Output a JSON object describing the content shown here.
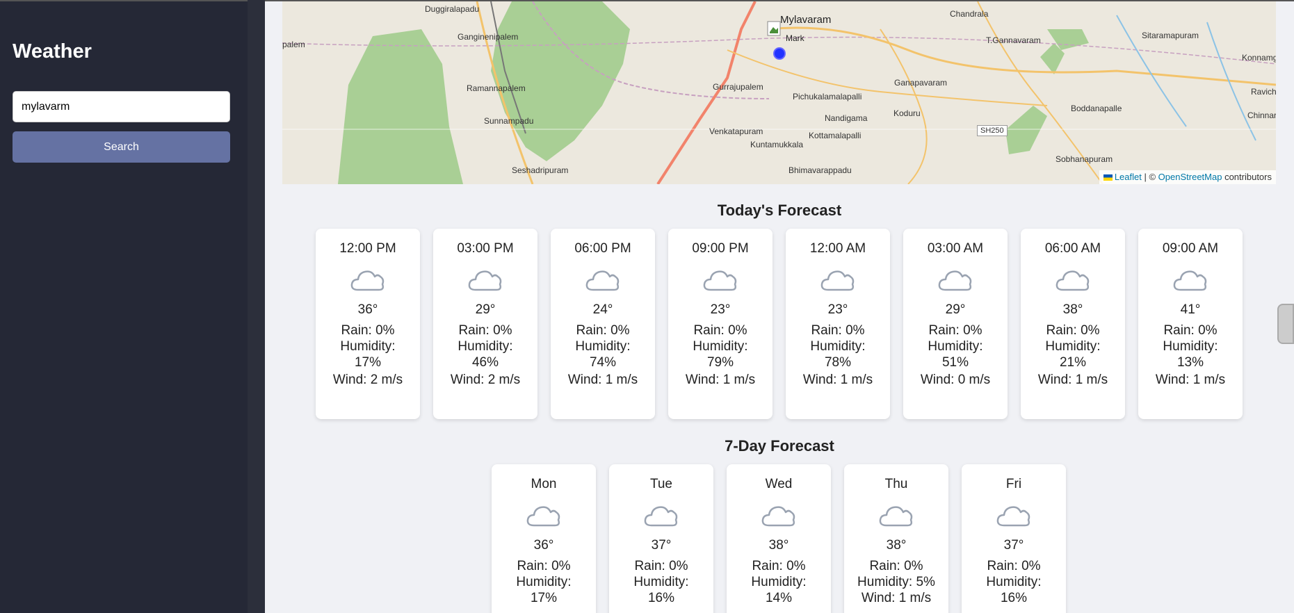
{
  "sidebar": {
    "title": "Weather",
    "search_value": "mylavarm",
    "search_button": "Search"
  },
  "map": {
    "labels": [
      "Duggiralapadu",
      "Ganginenipalem",
      "Ramannapalem",
      "Sunnampadu",
      "Seshadripuram",
      "palem",
      "Mylavaram",
      "Gurrajupalem",
      "Pichukalamalapalli",
      "Venkatapuram",
      "Kuntamukkala",
      "Kottamalapalli",
      "Nandigama",
      "Koduru",
      "Ganapavaram",
      "Chandrala",
      "T.Gannavaram",
      "Sitaramapuram",
      "Konnamgu",
      "Boddanapalle",
      "Ravich",
      "Chinnaravi",
      "Sobhanapuram",
      "Bhimavarappadu"
    ],
    "road_shield": "SH250",
    "marker_label": "Mark",
    "attribution": {
      "leaflet": "Leaflet",
      "separator": " | © ",
      "osm": "OpenStreetMap",
      "suffix": " contributors"
    }
  },
  "today": {
    "title": "Today's Forecast",
    "items": [
      {
        "time": "12:00 PM",
        "temp": "36°",
        "rain": "Rain: 0%",
        "humidity_label": "Humidity:",
        "humidity": "17%",
        "wind": "Wind: 2 m/s",
        "icon": "cloud-icon"
      },
      {
        "time": "03:00 PM",
        "temp": "29°",
        "rain": "Rain: 0%",
        "humidity_label": "Humidity:",
        "humidity": "46%",
        "wind": "Wind: 2 m/s",
        "icon": "cloud-icon"
      },
      {
        "time": "06:00 PM",
        "temp": "24°",
        "rain": "Rain: 0%",
        "humidity_label": "Humidity:",
        "humidity": "74%",
        "wind": "Wind: 1 m/s",
        "icon": "cloud-icon"
      },
      {
        "time": "09:00 PM",
        "temp": "23°",
        "rain": "Rain: 0%",
        "humidity_label": "Humidity:",
        "humidity": "79%",
        "wind": "Wind: 1 m/s",
        "icon": "cloud-icon"
      },
      {
        "time": "12:00 AM",
        "temp": "23°",
        "rain": "Rain: 0%",
        "humidity_label": "Humidity:",
        "humidity": "78%",
        "wind": "Wind: 1 m/s",
        "icon": "cloud-icon"
      },
      {
        "time": "03:00 AM",
        "temp": "29°",
        "rain": "Rain: 0%",
        "humidity_label": "Humidity:",
        "humidity": "51%",
        "wind": "Wind: 0 m/s",
        "icon": "cloud-icon"
      },
      {
        "time": "06:00 AM",
        "temp": "38°",
        "rain": "Rain: 0%",
        "humidity_label": "Humidity:",
        "humidity": "21%",
        "wind": "Wind: 1 m/s",
        "icon": "cloud-icon"
      },
      {
        "time": "09:00 AM",
        "temp": "41°",
        "rain": "Rain: 0%",
        "humidity_label": "Humidity:",
        "humidity": "13%",
        "wind": "Wind: 1 m/s",
        "icon": "cloud-icon"
      }
    ]
  },
  "week": {
    "title": "7-Day Forecast",
    "items": [
      {
        "day": "Mon",
        "temp": "36°",
        "rain": "Rain: 0%",
        "humidity_label": "Humidity:",
        "humidity": "17%",
        "icon": "cloud-icon"
      },
      {
        "day": "Tue",
        "temp": "37°",
        "rain": "Rain: 0%",
        "humidity_label": "Humidity:",
        "humidity": "16%",
        "icon": "cloud-icon"
      },
      {
        "day": "Wed",
        "temp": "38°",
        "rain": "Rain: 0%",
        "humidity_label": "Humidity:",
        "humidity": "14%",
        "icon": "cloud-icon"
      },
      {
        "day": "Thu",
        "temp": "38°",
        "rain": "Rain: 0%",
        "humidity_label": "Humidity: 5%",
        "humidity": "Wind: 1 m/s",
        "icon": "cloud-icon"
      },
      {
        "day": "Fri",
        "temp": "37°",
        "rain": "Rain: 0%",
        "humidity_label": "Humidity:",
        "humidity": "16%",
        "icon": "cloud-icon"
      }
    ]
  }
}
